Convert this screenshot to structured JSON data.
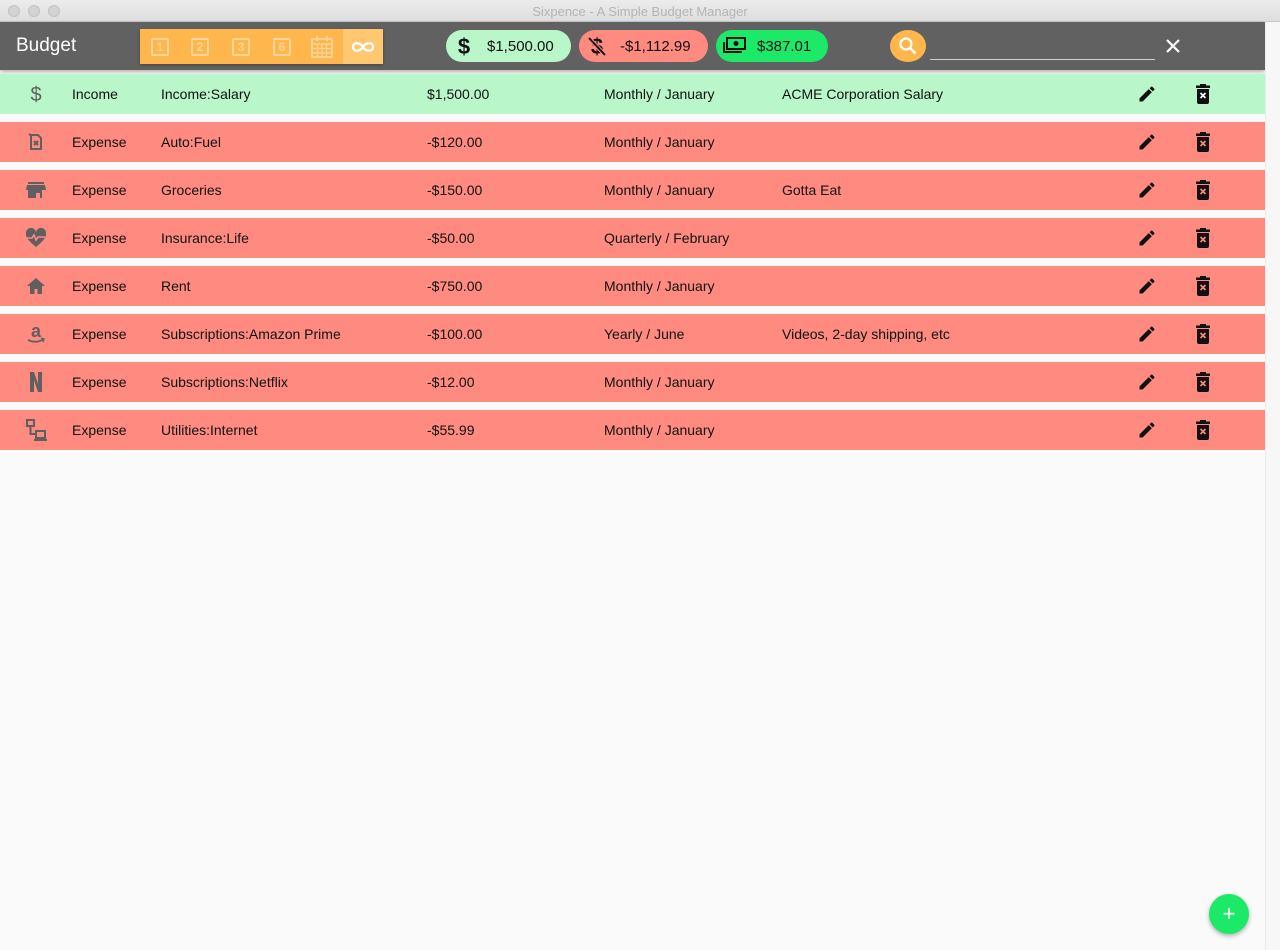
{
  "window": {
    "title": "Sixpence - A Simple Budget Manager"
  },
  "toolbar": {
    "title": "Budget",
    "periods": [
      {
        "name": "period-1-month-button",
        "label": "1",
        "icon": "looks-one-icon"
      },
      {
        "name": "period-2-month-button",
        "label": "2",
        "icon": "looks-two-icon"
      },
      {
        "name": "period-3-month-button",
        "label": "3",
        "icon": "looks-three-icon"
      },
      {
        "name": "period-6-month-button",
        "label": "6",
        "icon": "looks-six-icon"
      },
      {
        "name": "period-year-button",
        "icon": "calendar-icon"
      },
      {
        "name": "period-all-button",
        "icon": "infinity-icon",
        "active": true
      }
    ],
    "summary": {
      "income": "$1,500.00",
      "expense": "-$1,112.99",
      "balance": "$387.01"
    },
    "search": {
      "value": "",
      "placeholder": ""
    }
  },
  "entries": [
    {
      "icon": "dollar-icon",
      "type": "Income",
      "category": "Income:Salary",
      "amount": "$1,500.00",
      "recurrence": "Monthly / January",
      "note": "ACME Corporation Salary"
    },
    {
      "icon": "fuel-icon",
      "type": "Expense",
      "category": "Auto:Fuel",
      "amount": "-$120.00",
      "recurrence": "Monthly / January",
      "note": ""
    },
    {
      "icon": "store-icon",
      "type": "Expense",
      "category": "Groceries",
      "amount": "-$150.00",
      "recurrence": "Monthly / January",
      "note": "Gotta Eat"
    },
    {
      "icon": "heart-pulse-icon",
      "type": "Expense",
      "category": "Insurance:Life",
      "amount": "-$50.00",
      "recurrence": "Quarterly / February",
      "note": ""
    },
    {
      "icon": "home-icon",
      "type": "Expense",
      "category": "Rent",
      "amount": "-$750.00",
      "recurrence": "Monthly / January",
      "note": ""
    },
    {
      "icon": "amazon-icon",
      "type": "Expense",
      "category": "Subscriptions:Amazon Prime",
      "amount": "-$100.00",
      "recurrence": "Yearly / June",
      "note": "Videos, 2-day shipping, etc"
    },
    {
      "icon": "netflix-icon",
      "type": "Expense",
      "category": "Subscriptions:Netflix",
      "amount": "-$12.00",
      "recurrence": "Monthly / January",
      "note": ""
    },
    {
      "icon": "network-icon",
      "type": "Expense",
      "category": "Utilities:Internet",
      "amount": "-$55.99",
      "recurrence": "Monthly / January",
      "note": ""
    }
  ],
  "fab": {
    "label": "+"
  },
  "colors": {
    "toolbar": "#616161",
    "period_group": "#ffb74d",
    "income": "#b9f6ca",
    "expense": "#ff8a80",
    "balance": "#1de968",
    "icon": "#5f5f5f"
  }
}
